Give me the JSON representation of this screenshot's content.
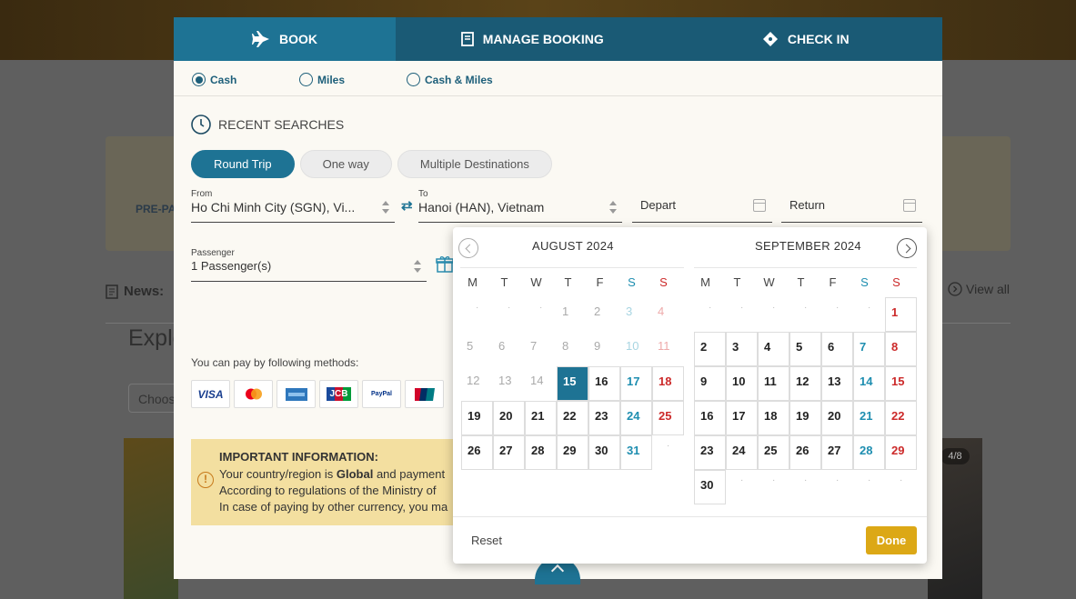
{
  "background": {
    "prepa_text": "PRE-PA",
    "news_label": "News:",
    "view_all": "View all",
    "explore_text": "Explo",
    "choose_text": "Choos",
    "photo_badge": "4/8"
  },
  "tabs": [
    {
      "label": "BOOK",
      "icon": "plane-icon"
    },
    {
      "label": "MANAGE BOOKING",
      "icon": "booking-icon"
    },
    {
      "label": "CHECK IN",
      "icon": "ticket-icon"
    }
  ],
  "payment_options": [
    {
      "label": "Cash",
      "selected": true
    },
    {
      "label": "Miles",
      "selected": false
    },
    {
      "label": "Cash & Miles",
      "selected": false
    }
  ],
  "recent_searches": "RECENT SEARCHES",
  "trip_types": [
    {
      "label": "Round Trip",
      "active": true
    },
    {
      "label": "One way",
      "active": false
    },
    {
      "label": "Multiple Destinations",
      "active": false
    }
  ],
  "from": {
    "label": "From",
    "value": "Ho Chi Minh City (SGN), Vi..."
  },
  "to": {
    "label": "To",
    "value": "Hanoi (HAN), Vietnam"
  },
  "depart": {
    "placeholder": "Depart"
  },
  "return": {
    "placeholder": "Return"
  },
  "passenger": {
    "label": "Passenger",
    "value": "1 Passenger(s)"
  },
  "pay_methods_label": "You can pay by following methods:",
  "cards": [
    "VISA",
    "mastercard",
    "amex",
    "JCB",
    "PayPal",
    "UnionPay"
  ],
  "important": {
    "title": "IMPORTANT INFORMATION:",
    "line1_pre": "Your country/region is ",
    "line1_bold": "Global",
    "line1_post": " and payment",
    "line2": "According to regulations of the Ministry of",
    "line3": "In case of paying by other currency, you ma"
  },
  "calendar": {
    "weekdays": [
      "M",
      "T",
      "W",
      "T",
      "F",
      "S",
      "S"
    ],
    "months": [
      {
        "title": "AUGUST 2024",
        "leading_blank": 3,
        "days": 31,
        "disabled_until": 14,
        "selected": 15
      },
      {
        "title": "SEPTEMBER 2024",
        "leading_blank": 6,
        "days": 30,
        "disabled_until": 0,
        "selected": null
      }
    ],
    "reset": "Reset",
    "done": "Done"
  },
  "colors": {
    "tab_bg": "#1a5a75",
    "accent": "#1e7394",
    "done_button": "#dca816",
    "saturday": "#1e8eb0",
    "sunday": "#cc2a2a"
  }
}
